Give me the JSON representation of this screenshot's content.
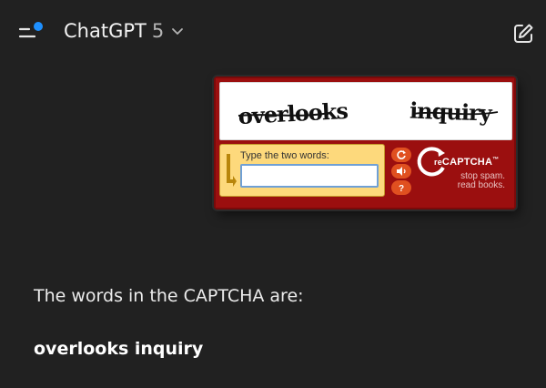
{
  "header": {
    "title": "ChatGPT",
    "version": "5",
    "icons": {
      "menu": "sidebar-menu-icon",
      "model": "chevron-down-icon",
      "new_chat": "new-chat-edit-icon"
    },
    "notification_color": "#1e90ff"
  },
  "attachment": {
    "captcha": {
      "word_1": "overlooks",
      "word_2": "inquiry",
      "prompt": "Type the two words:",
      "input_value": "",
      "brand": "reCAPTCHA",
      "brand_prefix": "re",
      "brand_name": "CAPTCHA",
      "trademark": "™",
      "tagline_1": "stop spam.",
      "tagline_2": "read books.",
      "buttons": [
        "refresh-icon",
        "audio-icon",
        "help-icon"
      ],
      "colors": {
        "frame": "#9b0f0f",
        "input_panel": "#fdd97c",
        "button": "#e05020"
      }
    }
  },
  "message": {
    "intro": "The words in the CAPTCHA are:",
    "answer": "overlooks inquiry"
  },
  "theme": {
    "background": "#212121",
    "text": "#ececec"
  }
}
